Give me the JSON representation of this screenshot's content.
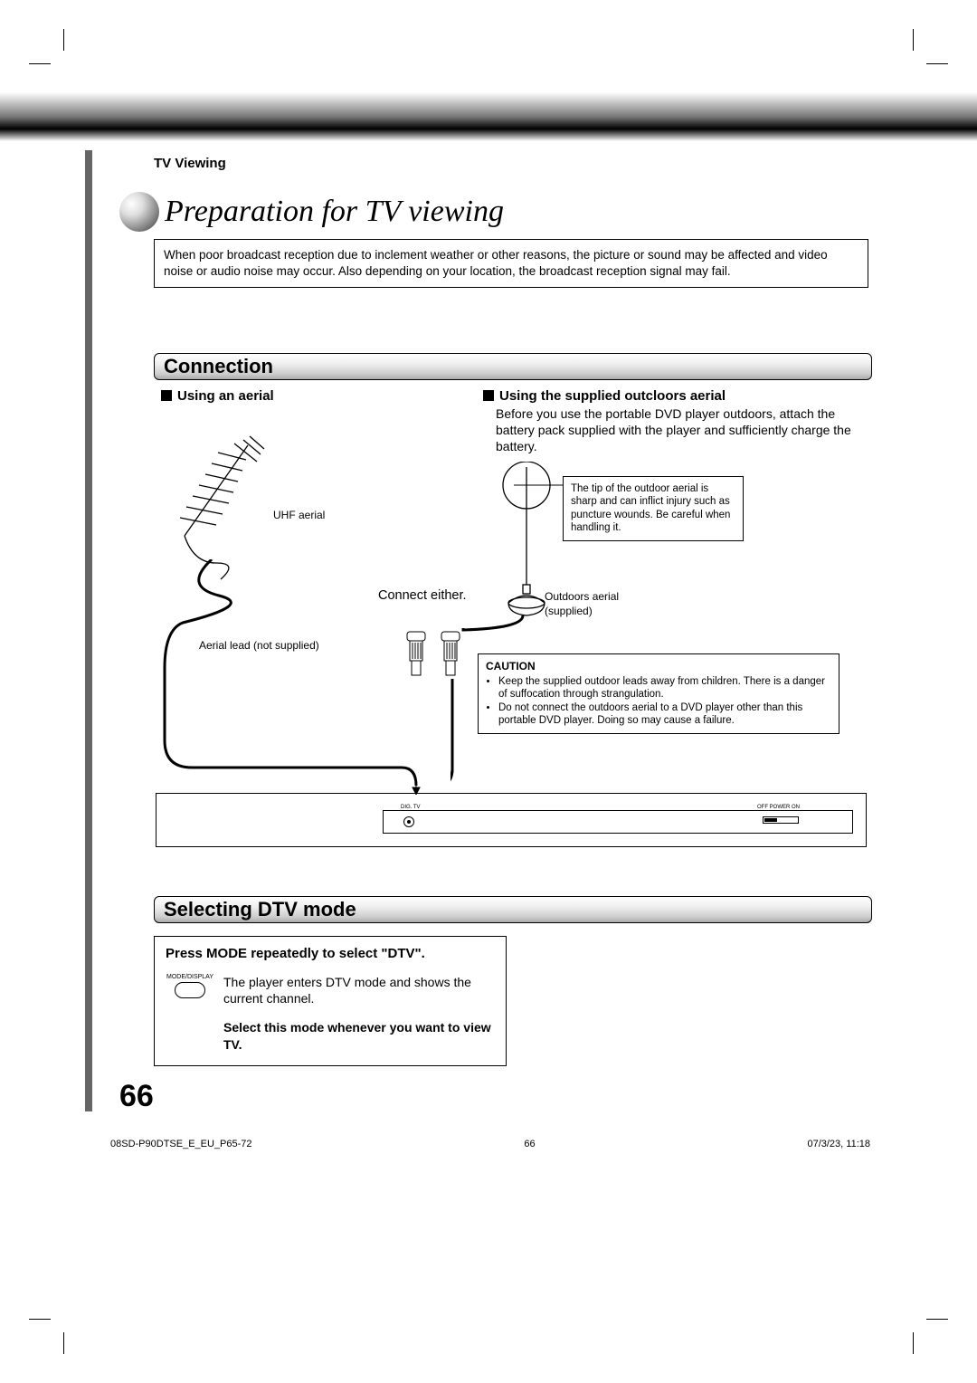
{
  "section_label": "TV Viewing",
  "title": "Preparation for TV viewing",
  "intro": "When poor broadcast reception due to inclement weather or other reasons, the picture or sound may be affected and video noise or audio noise may occur. Also depending on your location, the broadcast reception signal may fail.",
  "heads": {
    "connection": "Connection",
    "dtv": "Selecting DTV mode"
  },
  "sub": {
    "using_aerial": "Using an aerial",
    "outdoor": "Using the supplied outcloors aerial"
  },
  "outdoor_text": "Before you use the portable DVD player outdoors, attach the battery pack supplied with the player and sufficiently charge the battery.",
  "labels": {
    "uhf": "UHF aerial",
    "aerial_lead": "Aerial lead (not supplied)",
    "connect_either": "Connect either.",
    "outdoor_aerial": "Outdoors aerial",
    "supplied": "(supplied)",
    "dtv_jack": "DIG. TV",
    "power": "OFF   POWER   ON"
  },
  "tip_box": "The tip of the outdoor aerial is sharp and can inflict injury such as puncture wounds. Be careful when handling it.",
  "caution": {
    "title": "CAUTION",
    "items": [
      "Keep the supplied outdoor leads away from children. There is a danger of suffocation through strangulation.",
      "Do not connect the outdoors aerial to a DVD player other than this portable DVD player. Doing so may cause a failure."
    ]
  },
  "dtv": {
    "title": "Press MODE repeatedly to select \"DTV\".",
    "button_label": "MODE/DISPLAY",
    "text": "The player enters DTV mode and shows the current channel.",
    "bold": "Select this mode whenever you want to view TV."
  },
  "page_number": "66",
  "footer": {
    "left": "08SD-P90DTSE_E_EU_P65-72",
    "center": "66",
    "right": "07/3/23, 11:18"
  }
}
